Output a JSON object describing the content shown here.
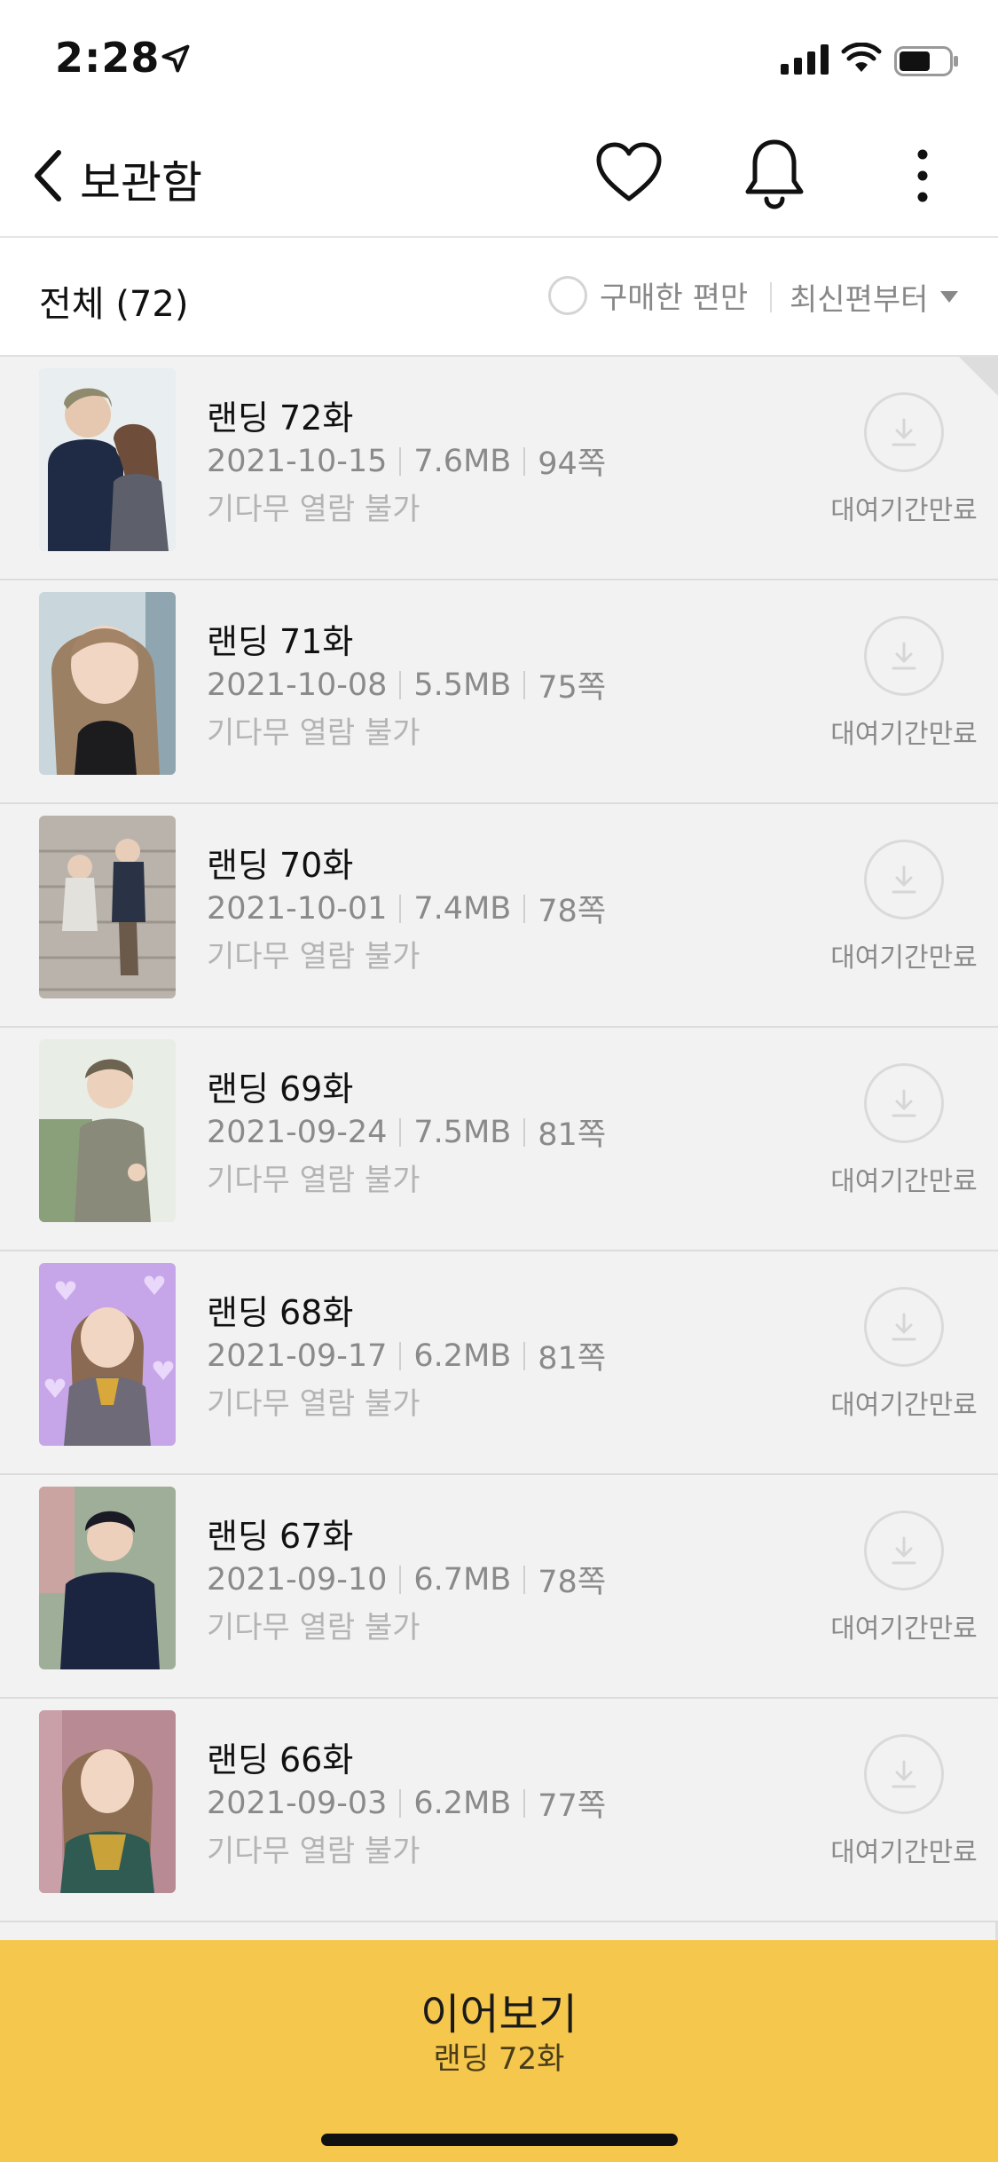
{
  "status_bar": {
    "time": "2:28"
  },
  "nav": {
    "title": "보관함"
  },
  "filter": {
    "all_label": "전체 (72)",
    "purchased_only_label": "구매한 편만",
    "sort_label": "최신편부터"
  },
  "episodes": [
    {
      "title": "랜딩 72화",
      "date": "2021-10-15",
      "size": "7.6MB",
      "pages": "94쪽",
      "status": "기다무 열람 불가",
      "expire": "대여기간만료"
    },
    {
      "title": "랜딩 71화",
      "date": "2021-10-08",
      "size": "5.5MB",
      "pages": "75쪽",
      "status": "기다무 열람 불가",
      "expire": "대여기간만료"
    },
    {
      "title": "랜딩 70화",
      "date": "2021-10-01",
      "size": "7.4MB",
      "pages": "78쪽",
      "status": "기다무 열람 불가",
      "expire": "대여기간만료"
    },
    {
      "title": "랜딩 69화",
      "date": "2021-09-24",
      "size": "7.5MB",
      "pages": "81쪽",
      "status": "기다무 열람 불가",
      "expire": "대여기간만료"
    },
    {
      "title": "랜딩 68화",
      "date": "2021-09-17",
      "size": "6.2MB",
      "pages": "81쪽",
      "status": "기다무 열람 불가",
      "expire": "대여기간만료"
    },
    {
      "title": "랜딩 67화",
      "date": "2021-09-10",
      "size": "6.7MB",
      "pages": "78쪽",
      "status": "기다무 열람 불가",
      "expire": "대여기간만료"
    },
    {
      "title": "랜딩 66화",
      "date": "2021-09-03",
      "size": "6.2MB",
      "pages": "77쪽",
      "status": "기다무 열람 불가",
      "expire": "대여기간만료"
    }
  ],
  "continue": {
    "label": "이어보기",
    "episode": "랜딩 72화"
  },
  "colors": {
    "accent_bar": "#f5c74c",
    "list_bg": "#f2f2f2",
    "muted_text": "#8a8a8a"
  }
}
